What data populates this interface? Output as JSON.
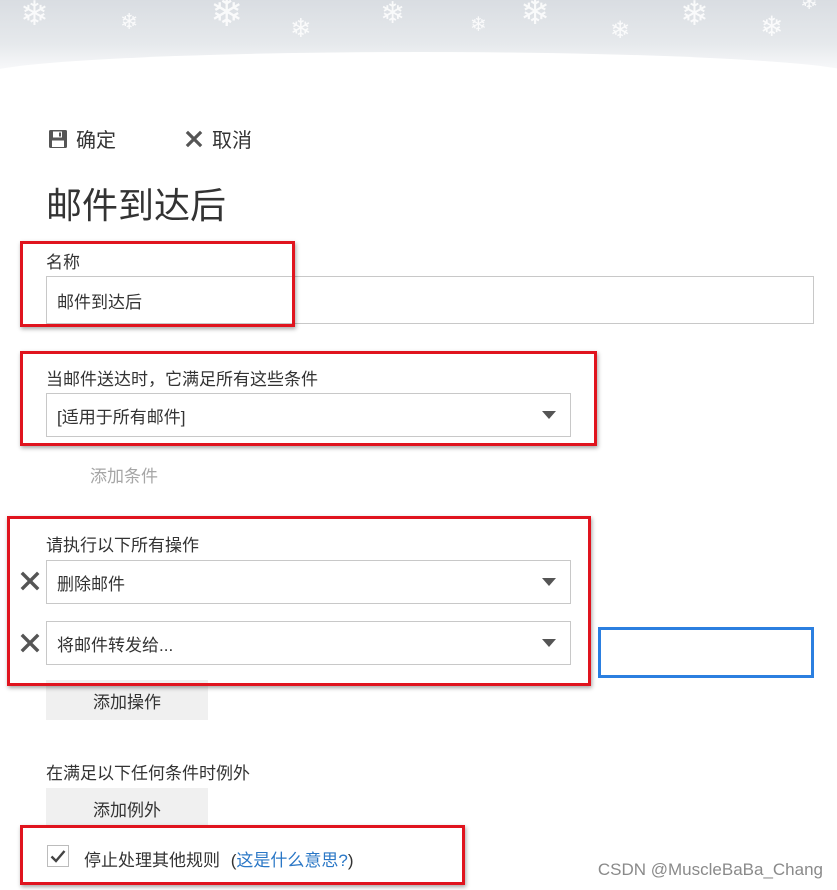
{
  "toolbar": {
    "ok_label": "确定",
    "cancel_label": "取消"
  },
  "page_title": "邮件到达后",
  "name_section": {
    "label": "名称",
    "value": "邮件到达后"
  },
  "conditions_section": {
    "label": "当邮件送达时，它满足所有这些条件",
    "selected": "[适用于所有邮件]",
    "add_label": "添加条件"
  },
  "actions_section": {
    "label": "请执行以下所有操作",
    "actions": [
      {
        "selected": "删除邮件"
      },
      {
        "selected": "将邮件转发给..."
      }
    ],
    "add_label": "添加操作"
  },
  "exceptions_section": {
    "label": "在满足以下任何条件时例外",
    "add_label": "添加例外"
  },
  "stop_processing": {
    "checked": true,
    "label": "停止处理其他规则",
    "paren_open": "(",
    "help_link": "这是什么意思?",
    "paren_close": ")"
  },
  "watermark": "CSDN @MuscleBaBa_Chang",
  "colors": {
    "annotation_red": "#e0141e",
    "annotation_blue": "#2b7fe0",
    "link_blue": "#2a77c6"
  },
  "icons": {
    "ok": "save-icon",
    "cancel": "close-icon",
    "remove_action": "close-icon",
    "dropdown": "caret-down-icon",
    "checkbox": "checkmark-icon"
  }
}
